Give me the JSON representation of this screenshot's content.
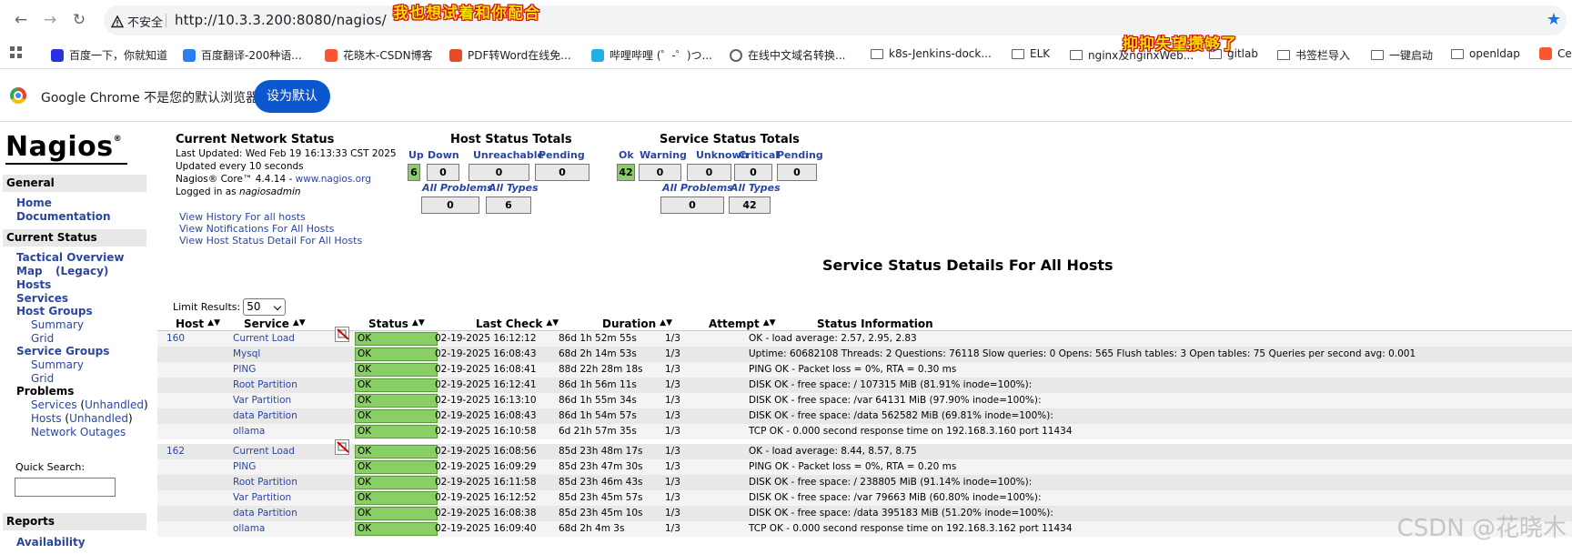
{
  "browser": {
    "security_label": "不安全",
    "url": "http://10.3.3.200:8080/nagios/",
    "overlay_text_1": "我也想试着和你配合",
    "overlay_text_2": "抑抑失望攒够了",
    "bookmarks": [
      {
        "label": "百度一下，你就知道",
        "icon": "baidu-icon",
        "color": "#2932e1"
      },
      {
        "label": "百度翻译-200种语...",
        "icon": "translate-icon",
        "color": "#2a7ff1"
      },
      {
        "label": "花晓木-CSDN博客",
        "icon": "csdn-icon",
        "color": "#fc5531"
      },
      {
        "label": "PDF转Word在线免...",
        "icon": "pdf-icon",
        "color": "#e54d26"
      },
      {
        "label": "哔哩哔哩 (゜-゜)つ...",
        "icon": "bilibili-icon",
        "color": "#23ade5"
      },
      {
        "label": "在线中文域名转换...",
        "icon": "globe-icon",
        "color": "#5f6368"
      },
      {
        "label": "k8s-Jenkins-dock...",
        "icon": "folder-icon",
        "color": "#5f6368"
      },
      {
        "label": "ELK",
        "icon": "folder-icon",
        "color": "#5f6368"
      },
      {
        "label": "nginx及nginxWeb...",
        "icon": "folder-icon",
        "color": "#5f6368"
      },
      {
        "label": "gitlab",
        "icon": "folder-icon",
        "color": "#5f6368"
      },
      {
        "label": "书签栏导入",
        "icon": "folder-icon",
        "color": "#5f6368"
      },
      {
        "label": "一键启动",
        "icon": "folder-icon",
        "color": "#5f6368"
      },
      {
        "label": "openldap",
        "icon": "folder-icon",
        "color": "#5f6368"
      },
      {
        "label": "Ce",
        "icon": "csdn-icon",
        "color": "#fc5531"
      }
    ],
    "infobar_text": "Google Chrome 不是您的默认浏览器",
    "infobar_button": "设为默认"
  },
  "sidebar": {
    "logo": "Nagios",
    "logo_reg": "®",
    "general_head": "General",
    "home": "Home",
    "documentation": "Documentation",
    "current_status_head": "Current Status",
    "tactical": "Tactical Overview",
    "map": "Map",
    "map_legacy": "(Legacy)",
    "hosts": "Hosts",
    "services": "Services",
    "host_groups": "Host Groups",
    "hg_summary": "Summary",
    "hg_grid": "Grid",
    "service_groups": "Service Groups",
    "sg_summary": "Summary",
    "sg_grid": "Grid",
    "problems": "Problems",
    "p_services": "Services",
    "p_services_unh": "Unhandled",
    "p_hosts": "Hosts",
    "p_hosts_unh": "Unhandled",
    "p_network": "Network Outages",
    "quick_search": "Quick Search:",
    "reports_head": "Reports",
    "availability": "Availability"
  },
  "status_info": {
    "title": "Current Network Status",
    "last_updated": "Last Updated: Wed Feb 19 16:13:33 CST 2025",
    "updated_every": "Updated every 10 seconds",
    "core_prefix": "Nagios® Core™ 4.4.14 - ",
    "core_link": "www.nagios.org",
    "logged_prefix": "Logged in as ",
    "logged_user": "nagiosadmin",
    "links": [
      "View History For all hosts",
      "View Notifications For All Hosts",
      "View Host Status Detail For All Hosts"
    ]
  },
  "host_totals": {
    "title": "Host Status Totals",
    "headers": [
      "Up",
      "Down",
      "Unreachable",
      "Pending"
    ],
    "values": [
      "6",
      "0",
      "0",
      "0"
    ],
    "sub_headers": [
      "All Problems",
      "All Types"
    ],
    "sub_values": [
      "0",
      "6"
    ]
  },
  "service_totals": {
    "title": "Service Status Totals",
    "headers": [
      "Ok",
      "Warning",
      "Unknown",
      "Critical",
      "Pending"
    ],
    "values": [
      "42",
      "0",
      "0",
      "0",
      "0"
    ],
    "sub_headers": [
      "All Problems",
      "All Types"
    ],
    "sub_values": [
      "0",
      "42"
    ]
  },
  "details": {
    "title": "Service Status Details For All Hosts",
    "limit_label": "Limit Results:",
    "limit_value": "50",
    "columns": [
      "Host",
      "Service",
      "Status",
      "Last Check",
      "Duration",
      "Attempt",
      "Status Information"
    ],
    "rows": [
      {
        "host": "160",
        "service": "Current Load",
        "status": "OK",
        "last": "02-19-2025 16:12:12",
        "dur": "86d 1h 52m 55s",
        "att": "1/3",
        "info": "OK - load average: 2.57, 2.95, 2.83"
      },
      {
        "host": "",
        "service": "Mysql",
        "status": "OK",
        "last": "02-19-2025 16:08:43",
        "dur": "68d 2h 14m 53s",
        "att": "1/3",
        "info": "Uptime: 60682108 Threads: 2 Questions: 76118 Slow queries: 0 Opens: 565 Flush tables: 3 Open tables: 75 Queries per second avg: 0.001"
      },
      {
        "host": "",
        "service": "PING",
        "status": "OK",
        "last": "02-19-2025 16:08:41",
        "dur": "88d 22h 28m 18s",
        "att": "1/3",
        "info": "PING OK - Packet loss = 0%, RTA = 0.30 ms"
      },
      {
        "host": "",
        "service": "Root Partition",
        "status": "OK",
        "last": "02-19-2025 16:12:41",
        "dur": "86d 1h 56m 11s",
        "att": "1/3",
        "info": "DISK OK - free space: / 107315 MiB (81.91% inode=100%):"
      },
      {
        "host": "",
        "service": "Var Partition",
        "status": "OK",
        "last": "02-19-2025 16:13:10",
        "dur": "86d 1h 55m 34s",
        "att": "1/3",
        "info": "DISK OK - free space: /var 64131 MiB (97.90% inode=100%):"
      },
      {
        "host": "",
        "service": "data Partition",
        "status": "OK",
        "last": "02-19-2025 16:08:43",
        "dur": "86d 1h 54m 57s",
        "att": "1/3",
        "info": "DISK OK - free space: /data 562582 MiB (69.81% inode=100%):"
      },
      {
        "host": "",
        "service": "ollama",
        "status": "OK",
        "last": "02-19-2025 16:10:58",
        "dur": "6d 21h 57m 35s",
        "att": "1/3",
        "info": "TCP OK - 0.000 second response time on 192.168.3.160 port 11434"
      },
      {
        "host": "162",
        "service": "Current Load",
        "status": "OK",
        "last": "02-19-2025 16:08:56",
        "dur": "85d 23h 48m 17s",
        "att": "1/3",
        "info": "OK - load average: 8.44, 8.57, 8.75"
      },
      {
        "host": "",
        "service": "PING",
        "status": "OK",
        "last": "02-19-2025 16:09:29",
        "dur": "85d 23h 47m 30s",
        "att": "1/3",
        "info": "PING OK - Packet loss = 0%, RTA = 0.20 ms"
      },
      {
        "host": "",
        "service": "Root Partition",
        "status": "OK",
        "last": "02-19-2025 16:11:58",
        "dur": "85d 23h 46m 43s",
        "att": "1/3",
        "info": "DISK OK - free space: / 238805 MiB (91.14% inode=100%):"
      },
      {
        "host": "",
        "service": "Var Partition",
        "status": "OK",
        "last": "02-19-2025 16:12:52",
        "dur": "85d 23h 45m 57s",
        "att": "1/3",
        "info": "DISK OK - free space: /var 79663 MiB (60.80% inode=100%):"
      },
      {
        "host": "",
        "service": "data Partition",
        "status": "OK",
        "last": "02-19-2025 16:08:38",
        "dur": "85d 23h 45m 10s",
        "att": "1/3",
        "info": "DISK OK - free space: /data 395183 MiB (51.20% inode=100%):"
      },
      {
        "host": "",
        "service": "ollama",
        "status": "OK",
        "last": "02-19-2025 16:09:40",
        "dur": "68d 2h 4m 3s",
        "att": "1/3",
        "info": "TCP OK - 0.000 second response time on 192.168.3.162 port 11434"
      }
    ]
  },
  "watermark": "CSDN @花晓木"
}
